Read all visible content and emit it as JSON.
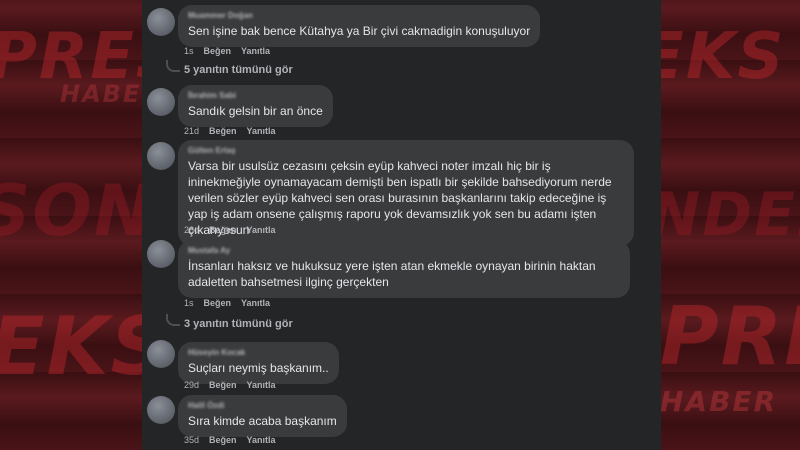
{
  "watermark": {
    "w1": "PRES",
    "w2": "EKS",
    "w3": "HABER",
    "w4": "SON D",
    "w5": "NDEM",
    "w6": "EKS",
    "w7": "PRES",
    "w8": "HABER"
  },
  "comments": [
    {
      "author": "Muammer Doğan",
      "text": "Sen işine bak bence Kütahya ya Bir çivi cakmadigin konuşuluyor",
      "time": "1s",
      "like": "Beğen",
      "reply": "Yanıtla",
      "more_replies": "5 yanıtın tümünü gör"
    },
    {
      "author": "İbrahim Sabi",
      "text": "Sandık gelsin bir an önce",
      "time": "21d",
      "like": "Beğen",
      "reply": "Yanıtla"
    },
    {
      "author": "Gülten Ertaş",
      "text": "Varsa bir usulsüz cezasını çeksin eyüp kahveci noter imzalı hiç bir iş ininekmeğiyle oynamayacam demişti ben ispatlı bir şekilde bahsediyorum nerde verilen sözler eyüp kahveci sen orası burasının başkanlarını takip edeceğine iş yap iş adam onsene çalışmış raporu yok devamsızlık yok sen bu adamı işten çıkarıyosun",
      "time": "28d",
      "like": "Beğen",
      "reply": "Yanıtla"
    },
    {
      "author": "Mustafa Ay",
      "text": "İnsanları haksız ve hukuksuz yere işten atan ekmekle oynayan birinin haktan adaletten bahsetmesi ilginç gerçekten",
      "time": "1s",
      "like": "Beğen",
      "reply": "Yanıtla",
      "more_replies": "3 yanıtın tümünü gör"
    },
    {
      "author": "Hüseyin Kocak",
      "text": "Suçları neymiş başkanım..",
      "time": "29d",
      "like": "Beğen",
      "reply": "Yanıtla"
    },
    {
      "author": "Halil Özdi",
      "text": "Sıra kimde acaba başkanım",
      "time": "35d",
      "like": "Beğen",
      "reply": "Yanıtla"
    }
  ]
}
